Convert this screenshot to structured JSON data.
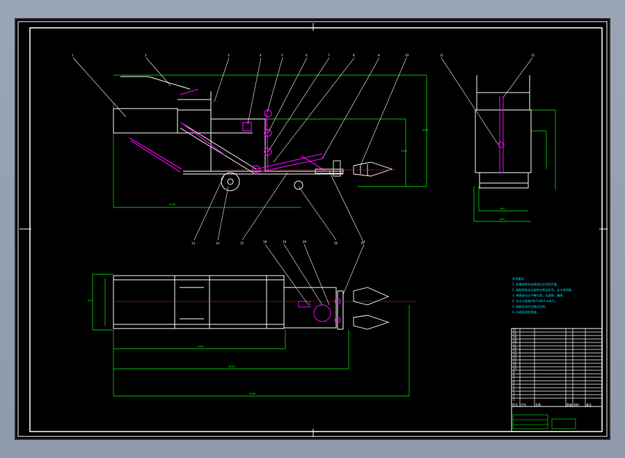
{
  "drawing": {
    "notes_heading": "技术要求",
    "notes": [
      "1. 各零部件的连接部位应牢固可靠。",
      "2. 装配时各运动部件应转动灵活，无卡滞现象。",
      "3. 焊接部位应平整光滑，无虚焊、漏焊。",
      "4. 未注公差按GB/T1804-m执行。",
      "5. 装配后进行空载试运转。",
      "6. 外表面涂防锈漆。"
    ],
    "balloons_top": [
      "1",
      "2",
      "3",
      "4",
      "5",
      "6",
      "7",
      "8",
      "9",
      "10",
      "11",
      "12"
    ],
    "balloons_bottom": [
      "13",
      "14",
      "15",
      "16",
      "17"
    ],
    "balloons_plan": [
      "18",
      "19",
      "20",
      "21"
    ],
    "dims_front": [
      "1660",
      "1900",
      "2550"
    ],
    "dims_side": [
      "850",
      "960"
    ],
    "dims_plan": [
      "1250",
      "1630",
      "2080",
      "930"
    ],
    "title_block": {
      "row_numbers": [
        "21",
        "20",
        "19",
        "18",
        "17",
        "16",
        "15",
        "14",
        "13",
        "12",
        "11",
        "10",
        "9",
        "8",
        "7",
        "6",
        "5",
        "4",
        "3",
        "2",
        "1"
      ],
      "header": [
        "序号",
        "代号",
        "名称",
        "数量",
        "材料",
        "备注"
      ]
    }
  }
}
